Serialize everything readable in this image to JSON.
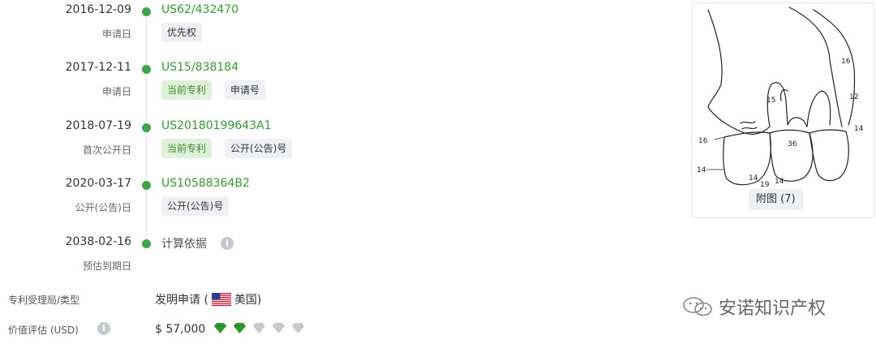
{
  "timeline": [
    {
      "date": "2016-12-09",
      "kind": "申请日",
      "number": "US62/432470",
      "tags": [
        "优先权"
      ]
    },
    {
      "date": "2017-12-11",
      "kind": "申请日",
      "number": "US15/838184",
      "tags": [
        "当前专利",
        "申请号"
      ]
    },
    {
      "date": "2018-07-19",
      "kind": "首次公开日",
      "number": "US20180199643A1",
      "tags": [
        "当前专利",
        "公开(公告)号"
      ]
    },
    {
      "date": "2020-03-17",
      "kind": "公开(公告)日",
      "number": "US10588364B2",
      "tags": [
        "公开(公告)号"
      ]
    },
    {
      "date": "2038-02-16",
      "kind": "预估到期日",
      "number": "计算依据",
      "tags": []
    }
  ],
  "info_icon_glyph": "i",
  "office": {
    "label": "专利受理局/类型",
    "value_prefix": "发明申请 (",
    "country": "美国",
    "value_suffix": ")"
  },
  "valuation": {
    "label": "价值评估 (USD)",
    "value": "$ 57,000",
    "rating": 2,
    "rating_max": 5
  },
  "figure": {
    "caption": "附图 (7)",
    "labels": [
      "16",
      "15",
      "12",
      "14",
      "16",
      "36",
      "14",
      "14",
      "14",
      "19"
    ]
  },
  "watermark": "安诺知识产权",
  "colors": {
    "green": "#3fa34d",
    "gem_active": "#2e9a2e",
    "gem_inactive": "#c6c9ce"
  }
}
